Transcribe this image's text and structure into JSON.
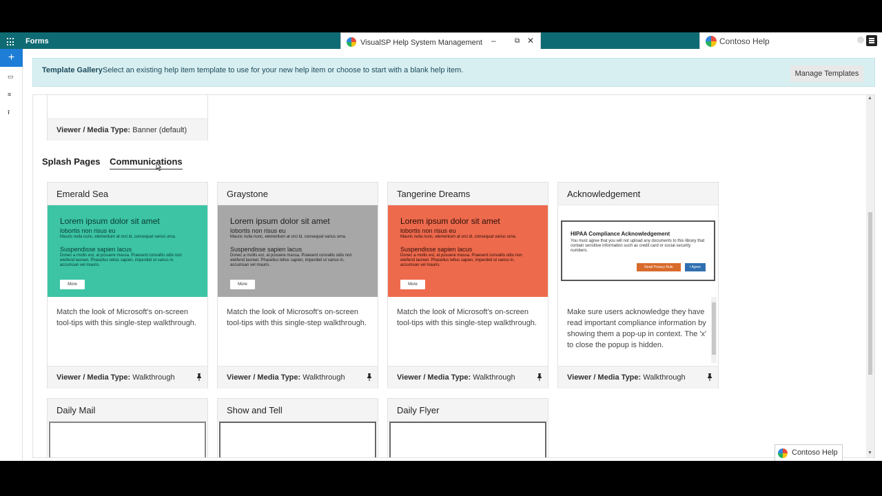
{
  "suitebar": {
    "app_title": "Forms"
  },
  "popup_window": {
    "title": "VisualSP Help System Management",
    "minimize": "–",
    "restore": "⧉",
    "close": "✕"
  },
  "help_bar": {
    "title": "Contoso Help"
  },
  "banner": {
    "lead": "Template Gallery",
    "text": "Select an existing help item template to use for your new help item or choose to start with a blank help item.",
    "manage_button": "Manage Templates"
  },
  "previous_card": {
    "media_label": "Viewer / Media Type:",
    "media_value": "Banner (default)"
  },
  "tabs": [
    {
      "label": "Splash Pages"
    },
    {
      "label": "Communications"
    }
  ],
  "preview": {
    "title": "Lorem ipsum dolor sit amet",
    "sub1": "lobortis non risus eu",
    "body1": "Mauris nulla nunc, elementum at orci id, consequat varius urna.",
    "sub2": "Suspendisse sapien lacus",
    "body2": "Donec a mollis est, at posuere massa. Praesent convallis odio non eleifend laoreet. Phasellus tellus sapien, imperdiet ut varius in, accumsan vel mauris.",
    "more": "More"
  },
  "cards": [
    {
      "title": "Emerald Sea",
      "desc": "Match the look of Microsoft's on-screen tool-tips with this single-step walkthrough.",
      "media_label": "Viewer / Media Type:",
      "media_value": "Walkthrough",
      "color": "#3cc4a5"
    },
    {
      "title": "Graystone",
      "desc": "Match the look of Microsoft's on-screen tool-tips with this single-step walkthrough.",
      "media_label": "Viewer / Media Type:",
      "media_value": "Walkthrough",
      "color": "#a7a7a7"
    },
    {
      "title": "Tangerine Dreams",
      "desc": "Match the look of Microsoft's on-screen tool-tips with this single-step walkthrough.",
      "media_label": "Viewer / Media Type:",
      "media_value": "Walkthrough",
      "color": "#ee6a4d"
    },
    {
      "title": "Acknowledgement",
      "desc": "Make sure users acknowledge they have read important compliance information by showing them a pop-up in context. The 'x' to close the popup is hidden.",
      "media_label": "Viewer / Media Type:",
      "media_value": "Walkthrough"
    }
  ],
  "ack_modal": {
    "title": "HIPAA Compliance Acknowledgement",
    "body": "You must agree that you will not upload any documents to this library that contain sensitive information such as credit card or social security numbers.",
    "btn_privacy": "Read Privacy Rule",
    "btn_agree": "I Agree"
  },
  "cards_row2": [
    {
      "title": "Daily Mail"
    },
    {
      "title": "Show and Tell"
    },
    {
      "title": "Daily Flyer"
    }
  ],
  "help_float": {
    "title": "Contoso Help"
  }
}
